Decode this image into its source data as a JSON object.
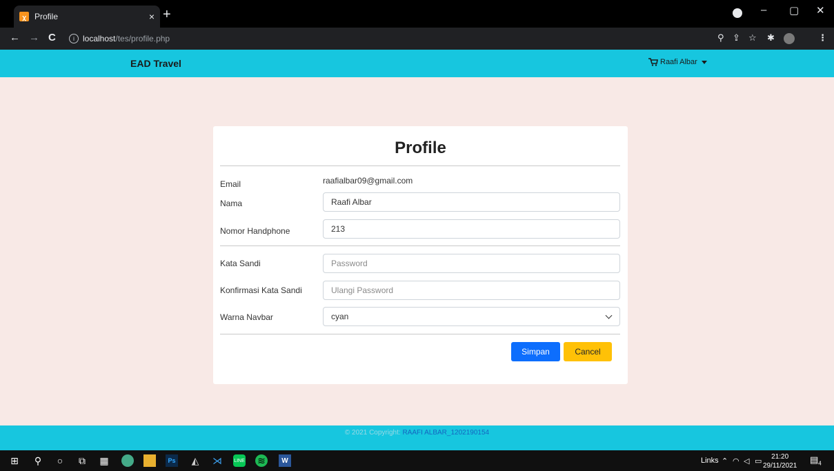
{
  "browser": {
    "tab_title": "Profile",
    "tab_close": "×",
    "new_tab": "+",
    "url_host": "localhost",
    "url_path": "/tes/profile.php",
    "nav": {
      "back": "←",
      "forward": "→",
      "reload": "C"
    },
    "icons": [
      "zoom-icon",
      "share-icon",
      "star-icon",
      "extensions-icon",
      "profile-avatar-icon",
      "menu-icon"
    ],
    "window": {
      "minimize": "–",
      "restore": "▢",
      "close": "✕"
    }
  },
  "navbar": {
    "brand": "EAD Travel",
    "user_name": "Raafi Albar",
    "bg_color": "#17c6df"
  },
  "profile": {
    "title": "Profile",
    "fields": {
      "email_label": "Email",
      "email_value": "raafialbar09@gmail.com",
      "name_label": "Nama",
      "name_value": "Raafi Albar",
      "phone_label": "Nomor Handphone",
      "phone_value": "213",
      "password_label": "Kata Sandi",
      "password_placeholder": "Password",
      "confirm_label": "Konfirmasi Kata Sandi",
      "confirm_placeholder": "Ulangi Password",
      "color_label": "Warna Navbar",
      "color_value": "cyan"
    },
    "buttons": {
      "save": "Simpan",
      "cancel": "Cancel"
    }
  },
  "footer": {
    "prefix": "© 2021 Copyright: ",
    "link": "RAAFI ALBAR_1202190154"
  },
  "taskbar": {
    "tray_links": "Links",
    "time": "21:20",
    "date": "29/11/2021",
    "notif_count": "4"
  }
}
